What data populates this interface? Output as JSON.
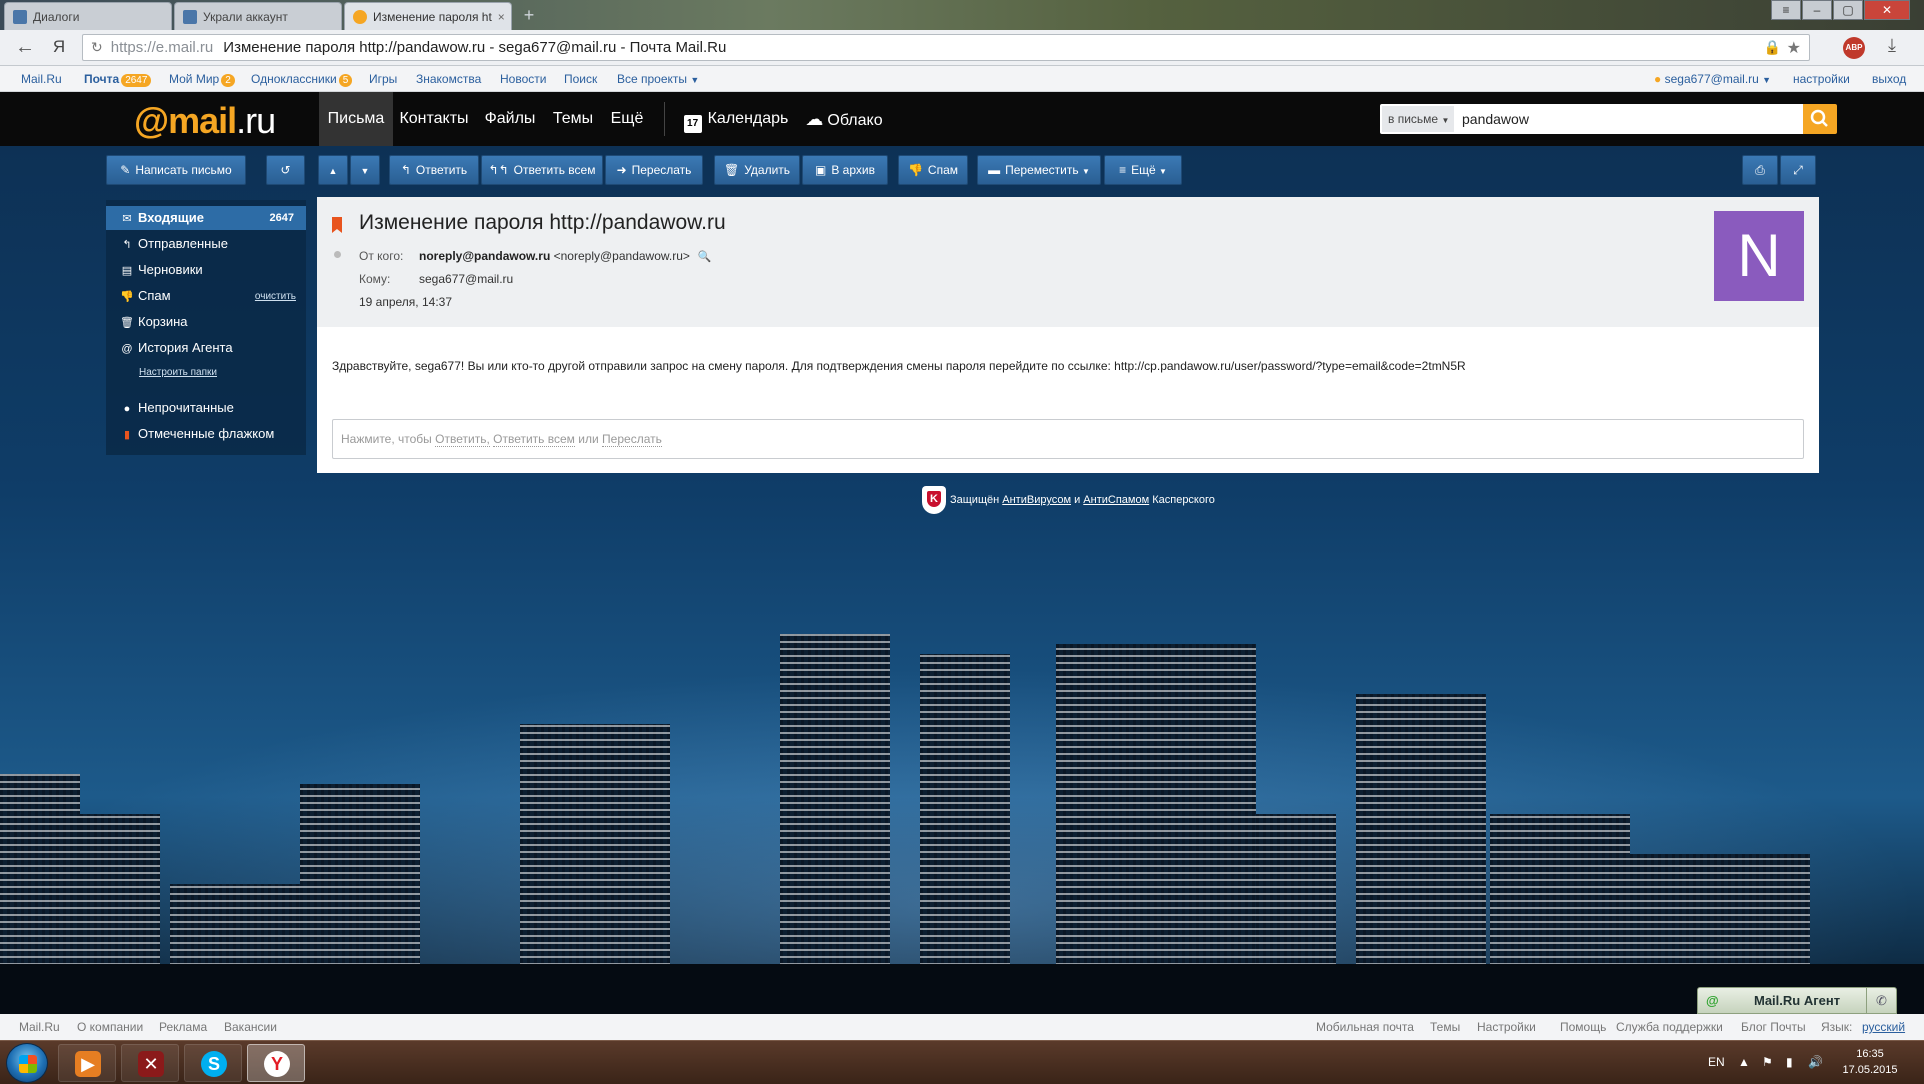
{
  "browser": {
    "tabs": [
      {
        "title": "Диалоги",
        "state": "inactive",
        "icon": "vk-icon"
      },
      {
        "title": "Украли аккаунт",
        "state": "inactive",
        "icon": "vk-icon"
      },
      {
        "title": "Изменение пароля ht",
        "state": "active",
        "icon": "mailru-icon"
      }
    ],
    "tab_close": "×",
    "new_tab": "+",
    "back_label": "←",
    "yandex_label": "Я",
    "url_host": "https://e.mail.ru",
    "url_title": "Изменение пароля http://pandawow.ru - sega677@mail.ru - Почта Mail.Ru",
    "ext_label": "ABP"
  },
  "portal": {
    "links": [
      "Mail.Ru",
      "Почта",
      "Мой Мир",
      "Одноклассники",
      "Игры",
      "Знакомства",
      "Новости",
      "Поиск",
      "Все проекты"
    ],
    "mail_count": "2647",
    "mir_count": "2",
    "ok_count": "5",
    "user": "sega677@mail.ru",
    "settings": "настройки",
    "logout": "выход"
  },
  "header": {
    "logo_at": "@mail",
    "logo_ru": ".ru",
    "nav": [
      "Письма",
      "Контакты",
      "Файлы",
      "Темы",
      "Ещё"
    ],
    "calendar": "Календарь",
    "calendar_day": "17",
    "cloud": "Облако",
    "search_scope": "в письме",
    "search_value": "pandawow"
  },
  "toolbar": {
    "compose": "Написать письмо",
    "reply": "Ответить",
    "reply_all": "Ответить всем",
    "forward": "Переслать",
    "delete": "Удалить",
    "archive": "В архив",
    "spam": "Спам",
    "move": "Переместить",
    "more": "Ещё"
  },
  "sidebar": {
    "items": [
      {
        "label": "Входящие",
        "badge": "2647",
        "icon": "envelope-icon"
      },
      {
        "label": "Отправленные",
        "icon": "sent-icon"
      },
      {
        "label": "Черновики",
        "icon": "draft-icon"
      },
      {
        "label": "Спам",
        "extra": "очистить",
        "icon": "thumb-down-icon"
      },
      {
        "label": "Корзина",
        "icon": "trash-icon"
      },
      {
        "label": "История Агента",
        "icon": "at-icon"
      }
    ],
    "setup_folders": "Настроить папки",
    "unread": "Непрочитанные",
    "flagged": "Отмеченные флажком"
  },
  "message": {
    "subject": "Изменение пароля http://pandawow.ru",
    "from_label": "От кого:",
    "from_name": "noreply@pandawow.ru",
    "from_email": "<noreply@pandawow.ru>",
    "to_label": "Кому:",
    "to": "sega677@mail.ru",
    "date": "19 апреля, 14:37",
    "avatar_letter": "N",
    "body": "Здравствуйте, sega677! Вы или кто-то другой отправили запрос на смену пароля. Для подтверждения смены пароля перейдите по ссылке: http://cp.pandawow.ru/user/password/?type=email&code=2tmN5R",
    "reply_prefix": "Нажмите, чтобы",
    "reply_link1": "Ответить,",
    "reply_link2": "Ответить всем",
    "reply_mid": "или",
    "reply_link3": "Переслать"
  },
  "kaspersky": {
    "prefix": "Защищён",
    "av": "АнтиВирусом",
    "and": "и",
    "as": "АнтиСпамом",
    "suffix": "Касперского"
  },
  "agent": {
    "at": "@",
    "label": "Mail.Ru Агент"
  },
  "footer": {
    "left": [
      "Mail.Ru",
      "О компании",
      "Реклама",
      "Вакансии"
    ],
    "right": [
      "Мобильная почта",
      "Темы",
      "Настройки",
      "Помощь",
      "Служба поддержки",
      "Блог Почты"
    ],
    "lang_label": "Язык:",
    "lang_value": "русский"
  },
  "taskbar": {
    "lang": "EN",
    "time": "16:35",
    "date": "17.05.2015"
  }
}
